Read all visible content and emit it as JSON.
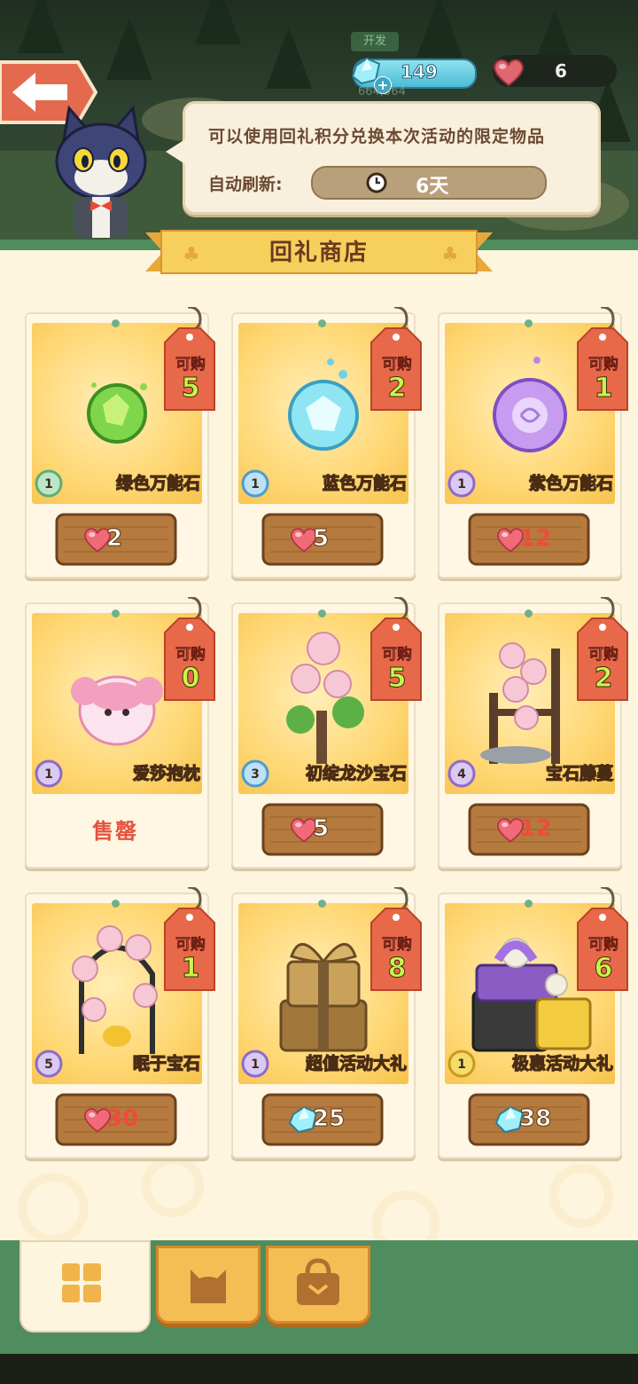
{
  "hud": {
    "dev_tag": "开发",
    "gems": "149",
    "gems_sub": "664,564",
    "hearts": "6"
  },
  "info": {
    "description": "可以使用回礼积分兑换本次活动的限定物品",
    "refresh_label": "自动刷新:",
    "refresh_value": "6天"
  },
  "shop": {
    "title": "回礼商店",
    "buy_label": "可购",
    "sold_out": "售罄",
    "items": [
      {
        "name": "绿色万能石",
        "stock": "5",
        "level": "1",
        "price": "2",
        "currency": "heart",
        "price_red": false,
        "sold_out": false,
        "art": "green-stone"
      },
      {
        "name": "蓝色万能石",
        "stock": "2",
        "level": "1",
        "price": "5",
        "currency": "heart",
        "price_red": false,
        "sold_out": false,
        "art": "blue-stone"
      },
      {
        "name": "紫色万能石",
        "stock": "1",
        "level": "1",
        "price": "12",
        "currency": "heart",
        "price_red": true,
        "sold_out": false,
        "art": "purple-stone"
      },
      {
        "name": "爱莎抱枕",
        "stock": "0",
        "level": "1",
        "price": "",
        "currency": "heart",
        "price_red": false,
        "sold_out": true,
        "art": "pillow"
      },
      {
        "name": "初绽龙沙宝石",
        "stock": "5",
        "level": "3",
        "price": "5",
        "currency": "heart",
        "price_red": false,
        "sold_out": false,
        "art": "rose-bush"
      },
      {
        "name": "宝石藤蔓",
        "stock": "2",
        "level": "4",
        "price": "12",
        "currency": "heart",
        "price_red": true,
        "sold_out": false,
        "art": "rose-vine"
      },
      {
        "name": "眠于宝石",
        "stock": "1",
        "level": "5",
        "price": "30",
        "currency": "heart",
        "price_red": true,
        "sold_out": false,
        "art": "rose-arch"
      },
      {
        "name": "超值活动大礼",
        "stock": "8",
        "level": "1",
        "price": "25",
        "currency": "gem",
        "price_red": false,
        "sold_out": false,
        "art": "gold-gift"
      },
      {
        "name": "极惠活动大礼",
        "stock": "6",
        "level": "1",
        "price": "38",
        "currency": "gem",
        "price_red": false,
        "sold_out": false,
        "art": "purple-gift"
      }
    ]
  },
  "tabs": [
    "grid-icon",
    "cat-icon",
    "bag-icon"
  ],
  "colors": {
    "accent_green": "#4f8c5e",
    "tag_orange": "#e8694a",
    "price_red": "#ef4b3c",
    "panel_bg": "#fdf5dd"
  }
}
